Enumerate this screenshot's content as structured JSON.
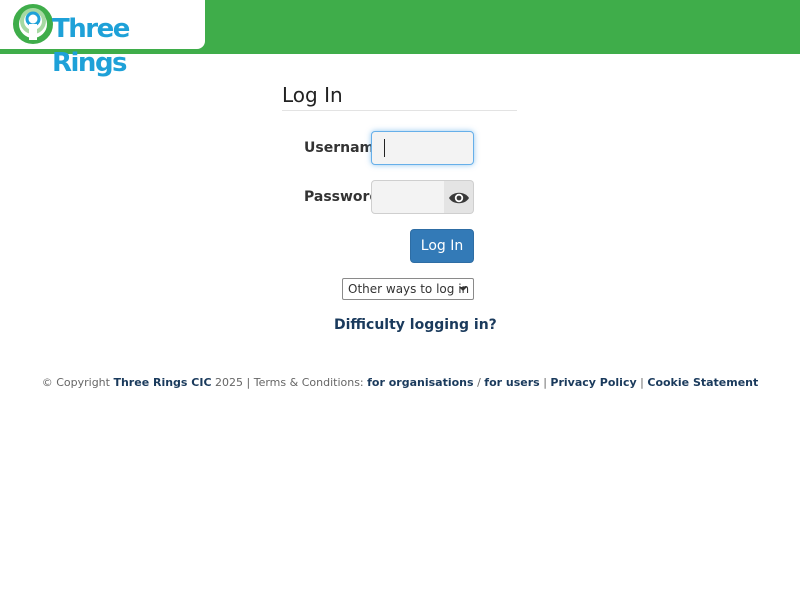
{
  "header": {
    "logo_text": "Three Rings",
    "bar_color": "#3fad4a",
    "logo_color": "#1ea1d8"
  },
  "login": {
    "title": "Log In",
    "username_label": "Username",
    "username_value": "",
    "password_label": "Password",
    "password_value": "",
    "show_password_icon": "eye-icon",
    "submit_label": "Log In",
    "other_ways_label": "Other ways to log in",
    "difficulty_link": "Difficulty logging in?",
    "button_color": "#337ab7"
  },
  "footer": {
    "copyright_prefix": "© Copyright",
    "company": "Three Rings CIC",
    "year_terms": "2025 | Terms & Conditions:",
    "for_organisations": "for organisations",
    "slash": "/",
    "for_users": "for users",
    "sep1": "|",
    "privacy_policy": "Privacy Policy",
    "sep2": "|",
    "cookie_statement": "Cookie Statement"
  }
}
